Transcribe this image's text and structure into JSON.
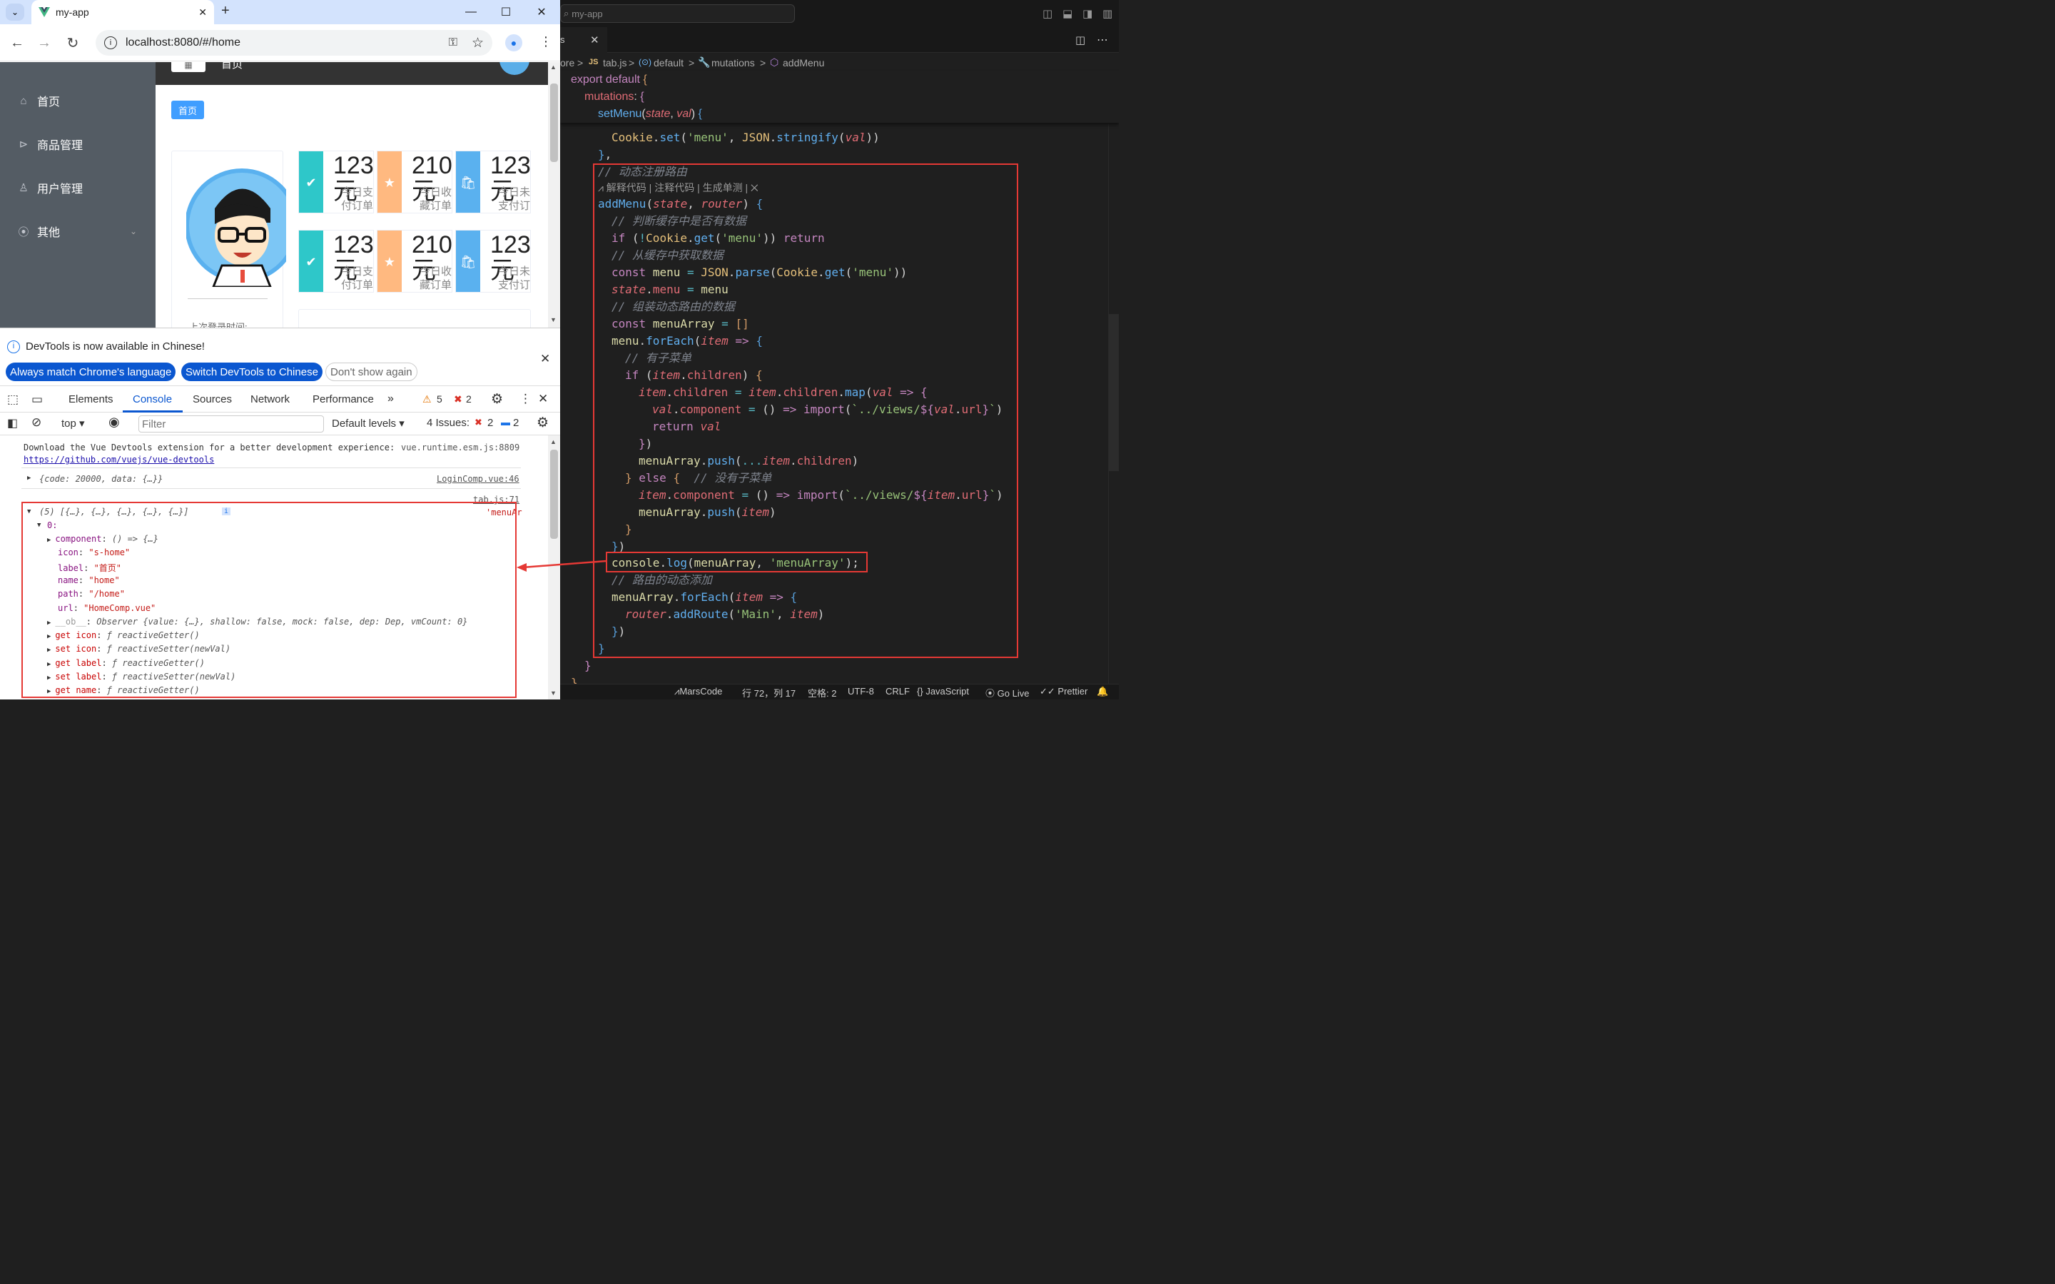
{
  "browser": {
    "tab_title": "my-app",
    "url": "localhost:8080/#/home"
  },
  "page": {
    "header_title": "首页",
    "breadcrumb_tag": "首页",
    "menu": [
      {
        "label": "首页",
        "icon": "home-icon"
      },
      {
        "label": "商品管理",
        "icon": "play-circle-icon"
      },
      {
        "label": "用户管理",
        "icon": "user-icon"
      },
      {
        "label": "其他",
        "icon": "location-icon"
      }
    ],
    "stats": [
      {
        "num": "123",
        "unit": "元",
        "label": "今日支付订单",
        "color": "#2ec7c9",
        "icon": "check-icon"
      },
      {
        "num": "210",
        "unit": "元",
        "label": "今日收藏订单",
        "color": "#ffb980",
        "icon": "star-icon"
      },
      {
        "num": "123",
        "unit": "元",
        "label": "今日未支付订单",
        "color": "#5ab1ef",
        "icon": "bag-icon"
      },
      {
        "num": "123",
        "unit": "元",
        "label": "今日支付订单",
        "color": "#2ec7c9",
        "icon": "check-icon"
      },
      {
        "num": "210",
        "unit": "元",
        "label": "今日收藏订单",
        "color": "#ffb980",
        "icon": "star-icon"
      },
      {
        "num": "123",
        "unit": "元",
        "label": "今日未支付订单",
        "color": "#5ab1ef",
        "icon": "bag-icon"
      }
    ],
    "last_login": "上次登录时间:"
  },
  "devtools": {
    "info": "DevTools is now available in Chinese!",
    "btn_match": "Always match Chrome's language",
    "btn_switch": "Switch DevTools to Chinese",
    "btn_dont": "Don't show again",
    "tabs": [
      "Elements",
      "Console",
      "Sources",
      "Network",
      "Performance"
    ],
    "warnings": "5",
    "errors": "2",
    "context": "top",
    "filter_placeholder": "Filter",
    "levels": "Default levels",
    "issues_label": "4 Issues:",
    "issues_err": "2",
    "issues_info": "2",
    "console": {
      "l1": "Download the Vue Devtools extension for a better development experience:",
      "l1src": "vue.runtime.esm.js:8809",
      "l2": "https://github.com/vuejs/vue-devtools",
      "l3": "{code: 20000, data: {…}}",
      "l3src": "LoginComp.vue:46",
      "l4src": "tab.js:71",
      "l4": "(5) [{…}, {…}, {…}, {…}, {…}]",
      "l4tail": "'menuAr",
      "l5": "0:",
      "props": [
        {
          "k": "component",
          "v": "() => {…}"
        },
        {
          "k": "icon",
          "v": "\"s-home\""
        },
        {
          "k": "label",
          "v": "\"首页\""
        },
        {
          "k": "name",
          "v": "\"home\""
        },
        {
          "k": "path",
          "v": "\"/home\""
        },
        {
          "k": "url",
          "v": "\"HomeComp.vue\""
        },
        {
          "k": "__ob__",
          "v": "Observer {value: {…}, shallow: false, mock: false, dep: Dep, vmCount: 0}"
        },
        {
          "k": "get icon",
          "v": "ƒ reactiveGetter()"
        },
        {
          "k": "set icon",
          "v": "ƒ reactiveSetter(newVal)"
        },
        {
          "k": "get label",
          "v": "ƒ reactiveGetter()"
        },
        {
          "k": "set label",
          "v": "ƒ reactiveSetter(newVal)"
        },
        {
          "k": "get name",
          "v": "ƒ reactiveGetter()"
        }
      ]
    }
  },
  "vscode": {
    "search": "my-app",
    "breadcrumb": [
      "ore",
      "tab.js",
      "default",
      "mutations",
      "addMenu"
    ],
    "codelens": "解释代码 | 注释代码 | 生成单测 |",
    "status": {
      "marscode": "MarsCode",
      "pos": "行 72，列 17",
      "spaces": "空格: 2",
      "enc": "UTF-8",
      "eol": "CRLF",
      "lang": "JavaScript",
      "golive": "Go Live",
      "prettier": "Prettier"
    }
  },
  "colors": {
    "accent": "#409eff",
    "annotation": "#e53935"
  }
}
